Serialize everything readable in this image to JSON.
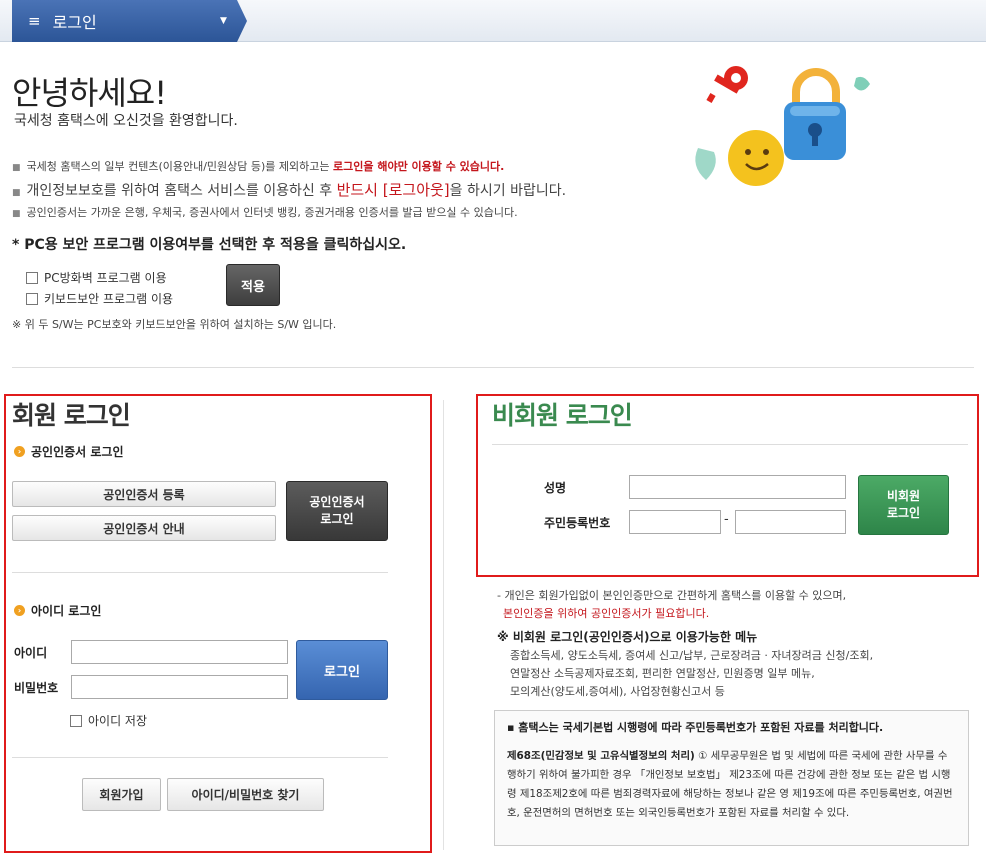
{
  "topbar": {
    "menu_icon": "≡",
    "tab_title": "로그인",
    "caret": "▼"
  },
  "greeting": {
    "title": "안녕하세요!",
    "subtitle": "국세청 홈택스에 오신것을 환영합니다."
  },
  "notices": {
    "n1_pre": "국세청 홈택스의 일부 컨텐츠(이용안내/민원상담 등)를 제외하고는 ",
    "n1_red": "로그인을 해야만 이용할 수 있습니다.",
    "n2_pre": "개인정보보호를 위하여 홈택스 서비스를 이용하신 후 ",
    "n2_red": "반드시 [로그아웃]",
    "n2_post": "을 하시기 바랍니다.",
    "n3": "공인인증서는 가까운 은행, 우체국, 증권사에서 인터넷 뱅킹, 증권거래용 인증서를 발급 받으실 수 있습니다."
  },
  "security": {
    "title": "* PC용 보안 프로그램 이용여부를 선택한 후 적용을 클릭하십시오.",
    "opt1": "PC방화벽 프로그램 이용",
    "opt2": "키보드보안 프로그램 이용",
    "apply": "적용",
    "note": "※ 위 두 S/W는 PC보호와 키보드보안을 위하여 설치하는 S/W 입니다."
  },
  "member": {
    "title": "회원 로그인",
    "cert_head": "공인인증서 로그인",
    "cert_register": "공인인증서 등록",
    "cert_guide": "공인인증서 안내",
    "cert_login_l1": "공인인증서",
    "cert_login_l2": "로그인",
    "id_head": "아이디 로그인",
    "id_label": "아이디",
    "pw_label": "비밀번호",
    "login": "로그인",
    "save_id": "아이디 저장",
    "join": "회원가입",
    "find": "아이디/비밀번호 찾기"
  },
  "nonmember": {
    "title": "비회원 로그인",
    "name_label": "성명",
    "rrn_label": "주민등록번호",
    "dash": "-",
    "login_l1": "비회원",
    "login_l2": "로그인"
  },
  "nonmember_info": {
    "l1": "- 개인은 회원가입없이 본인인증만으로 간편하게 홈택스를 이용할 수 있으며,",
    "l2": "본인인증을 위하여 공인인증서가 필요합니다.",
    "menu_title": "※ 비회원 로그인(공인인증서)으로 이용가능한 메뉴",
    "m1": "종합소득세, 양도소득세, 증여세 신고/납부, 근로장려금 · 자녀장려금 신청/조회,",
    "m2": "연말정산 소득공제자료조회, 편리한 연말정산, 민원증명 일부 메뉴,",
    "m3": "모의계산(양도세,증여세), 사업장현황신고서 등"
  },
  "notice_box": {
    "title": "▪ 홈택스는 국세기본법 시행령에 따라 주민등록번호가 포함된 자료를 처리합니다.",
    "law_bold": "제68조(민감정보 및 고유식별정보의 처리)",
    "law_text": " ① 세무공무원은 법 및 세법에 따른 국세에 관한 사무를 수행하기 위하여 불가피한 경우 「개인정보 보호법」 제23조에 따른 건강에 관한 정보 또는 같은 법 시행령 제18조제2호에 따른 범죄경력자료에 해당하는 정보나 같은 영 제19조에 따른 주민등록번호, 여권번호, 운전면허의 면허번호 또는 외국인등록번호가 포함된 자료를 처리할 수 있다."
  }
}
